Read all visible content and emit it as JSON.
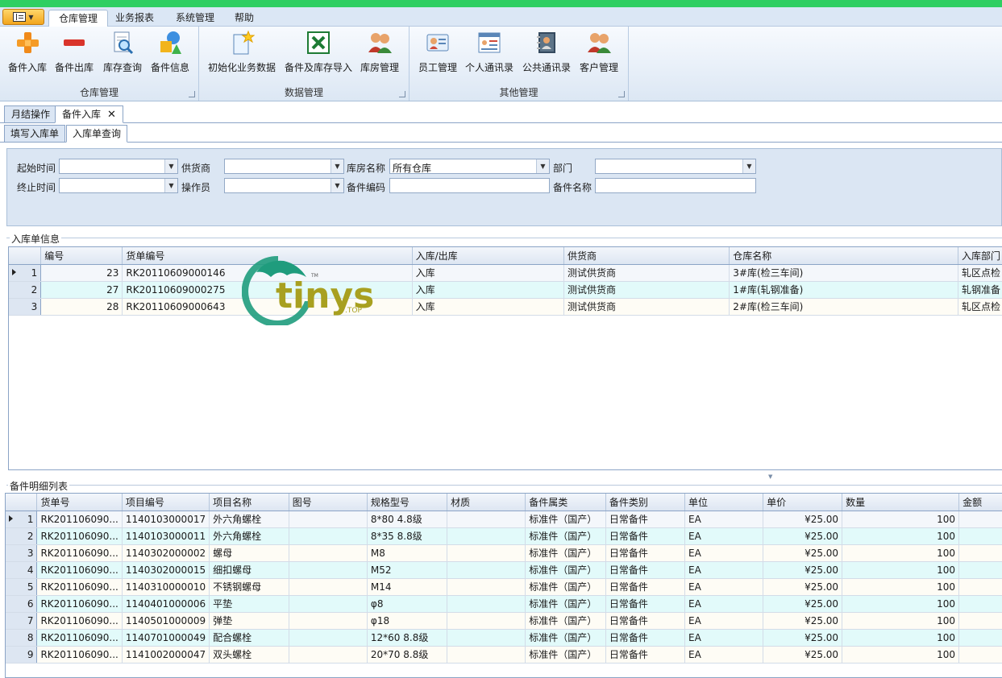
{
  "ribbon_tabs": [
    "仓库管理",
    "业务报表",
    "系统管理",
    "帮助"
  ],
  "groups": [
    {
      "title": "仓库管理",
      "buttons": [
        "备件入库",
        "备件出库",
        "库存查询",
        "备件信息"
      ]
    },
    {
      "title": "数据管理",
      "buttons": [
        "初始化业务数据",
        "备件及库存导入",
        "库房管理"
      ]
    },
    {
      "title": "其他管理",
      "buttons": [
        "员工管理",
        "个人通讯录",
        "公共通讯录",
        "客户管理"
      ]
    }
  ],
  "doc_tabs": [
    "月结操作",
    "备件入库"
  ],
  "sub_tabs": [
    "填写入库单",
    "入库单查询"
  ],
  "filter": {
    "start_time": "起始时间",
    "supplier": "供货商",
    "warehouse_name": "库房名称",
    "warehouse_value": "所有仓库",
    "dept": "部门",
    "end_time": "终止时间",
    "operator": "操作员",
    "part_code": "备件编码",
    "part_name": "备件名称"
  },
  "receipt_section": "入库单信息",
  "receipt_headers": [
    "编号",
    "货单编号",
    "入库/出库",
    "供货商",
    "仓库名称",
    "入库部门"
  ],
  "receipts": [
    {
      "idx": "1",
      "no": "23",
      "bill": "RK20110609000146",
      "type": "入库",
      "supplier": "测试供货商",
      "wh": "3#库(检三车间)",
      "dept": "轧区点检"
    },
    {
      "idx": "2",
      "no": "27",
      "bill": "RK20110609000275",
      "type": "入库",
      "supplier": "测试供货商",
      "wh": "1#库(轧钢准备)",
      "dept": "轧钢准备"
    },
    {
      "idx": "3",
      "no": "28",
      "bill": "RK20110609000643",
      "type": "入库",
      "supplier": "测试供货商",
      "wh": "2#库(检三车间)",
      "dept": "轧区点检"
    }
  ],
  "detail_section": "备件明细列表",
  "detail_headers": [
    "货单号",
    "项目编号",
    "项目名称",
    "图号",
    "规格型号",
    "材质",
    "备件属类",
    "备件类别",
    "单位",
    "单价",
    "数量",
    "金额"
  ],
  "details": [
    {
      "idx": "1",
      "bill": "RK201106090...",
      "code": "1140103000017",
      "name": "外六角螺栓",
      "drawing": "",
      "spec": "8*80   4.8级",
      "material": "",
      "attr": "标准件（国产）",
      "cat": "日常备件",
      "unit": "EA",
      "price": "¥25.00",
      "qty": "100",
      "amount": ""
    },
    {
      "idx": "2",
      "bill": "RK201106090...",
      "code": "1140103000011",
      "name": "外六角螺栓",
      "drawing": "",
      "spec": "8*35   8.8级",
      "material": "",
      "attr": "标准件（国产）",
      "cat": "日常备件",
      "unit": "EA",
      "price": "¥25.00",
      "qty": "100",
      "amount": ""
    },
    {
      "idx": "3",
      "bill": "RK201106090...",
      "code": "1140302000002",
      "name": "螺母",
      "drawing": "",
      "spec": "M8",
      "material": "",
      "attr": "标准件（国产）",
      "cat": "日常备件",
      "unit": "EA",
      "price": "¥25.00",
      "qty": "100",
      "amount": ""
    },
    {
      "idx": "4",
      "bill": "RK201106090...",
      "code": "1140302000015",
      "name": "细扣螺母",
      "drawing": "",
      "spec": "M52",
      "material": "",
      "attr": "标准件（国产）",
      "cat": "日常备件",
      "unit": "EA",
      "price": "¥25.00",
      "qty": "100",
      "amount": ""
    },
    {
      "idx": "5",
      "bill": "RK201106090...",
      "code": "1140310000010",
      "name": "不锈钢螺母",
      "drawing": "",
      "spec": "M14",
      "material": "",
      "attr": "标准件（国产）",
      "cat": "日常备件",
      "unit": "EA",
      "price": "¥25.00",
      "qty": "100",
      "amount": ""
    },
    {
      "idx": "6",
      "bill": "RK201106090...",
      "code": "1140401000006",
      "name": "平垫",
      "drawing": "",
      "spec": "φ8",
      "material": "",
      "attr": "标准件（国产）",
      "cat": "日常备件",
      "unit": "EA",
      "price": "¥25.00",
      "qty": "100",
      "amount": ""
    },
    {
      "idx": "7",
      "bill": "RK201106090...",
      "code": "1140501000009",
      "name": "弹垫",
      "drawing": "",
      "spec": "φ18",
      "material": "",
      "attr": "标准件（国产）",
      "cat": "日常备件",
      "unit": "EA",
      "price": "¥25.00",
      "qty": "100",
      "amount": ""
    },
    {
      "idx": "8",
      "bill": "RK201106090...",
      "code": "1140701000049",
      "name": "配合螺栓",
      "drawing": "",
      "spec": "12*60  8.8级",
      "material": "",
      "attr": "标准件（国产）",
      "cat": "日常备件",
      "unit": "EA",
      "price": "¥25.00",
      "qty": "100",
      "amount": ""
    },
    {
      "idx": "9",
      "bill": "RK201106090...",
      "code": "1141002000047",
      "name": "双头螺栓",
      "drawing": "",
      "spec": "20*70  8.8级",
      "material": "",
      "attr": "标准件（国产）",
      "cat": "日常备件",
      "unit": "EA",
      "price": "¥25.00",
      "qty": "100",
      "amount": ""
    }
  ],
  "watermark": {
    "text": "tinys",
    "suffix": ".TOP",
    "tm": "TM"
  }
}
